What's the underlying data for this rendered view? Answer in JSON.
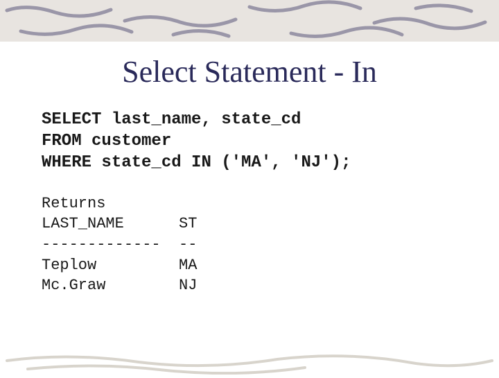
{
  "title": "Select Statement - In",
  "sql": {
    "line1": "SELECT last_name, state_cd",
    "line2": "FROM customer",
    "line3": "WHERE state_cd IN ('MA', 'NJ');"
  },
  "results": {
    "returns_label": "Returns",
    "header_col1": "LAST_NAME",
    "header_col2": "ST",
    "divider_col1": "-------------",
    "divider_col2": "--",
    "rows": [
      {
        "name": "Teplow",
        "st": "MA"
      },
      {
        "name": "Mc.Graw",
        "st": "NJ"
      }
    ]
  }
}
